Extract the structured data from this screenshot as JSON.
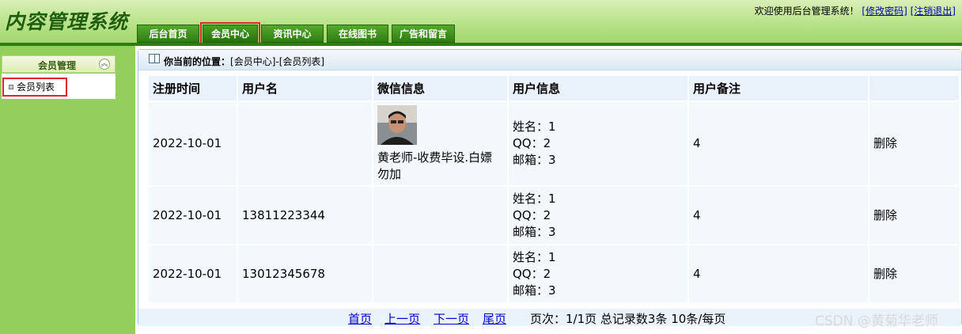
{
  "app": {
    "title": "内容管理系统"
  },
  "header": {
    "welcome_text": "欢迎使用后台管理系统！",
    "change_password": "[修改密码]",
    "logout": "[注销退出]"
  },
  "tabs": [
    {
      "label": "后台首页",
      "active": false
    },
    {
      "label": "会员中心",
      "active": true
    },
    {
      "label": "资讯中心",
      "active": false
    },
    {
      "label": "在线图书",
      "active": false
    },
    {
      "label": "广告和留言",
      "active": false
    }
  ],
  "sidebar": {
    "section_title": "会员管理",
    "items": [
      {
        "label": "会员列表",
        "selected": true
      }
    ]
  },
  "location": {
    "prefix": "你当前的位置：",
    "path": "[会员中心]-[会员列表]"
  },
  "table": {
    "headers": [
      "注册时间",
      "用户名",
      "微信信息",
      "用户信息",
      "用户备注",
      ""
    ],
    "rows": [
      {
        "reg_time": "2022-10-01",
        "username": "",
        "wechat_name": "黄老师-收费毕设.白嫖勿加",
        "has_avatar": true,
        "info_name": "姓名：1",
        "info_qq": "QQ：2",
        "info_email": "邮箱：3",
        "remark": "4",
        "action": "删除"
      },
      {
        "reg_time": "2022-10-01",
        "username": "13811223344",
        "wechat_name": "",
        "has_avatar": false,
        "info_name": "姓名：1",
        "info_qq": "QQ：2",
        "info_email": "邮箱：3",
        "remark": "4",
        "action": "删除"
      },
      {
        "reg_time": "2022-10-01",
        "username": "13012345678",
        "wechat_name": "",
        "has_avatar": false,
        "info_name": "姓名：1",
        "info_qq": "QQ：2",
        "info_email": "邮箱：3",
        "remark": "4",
        "action": "删除"
      }
    ]
  },
  "pager": {
    "first": "首页",
    "prev": "上一页",
    "next": "下一页",
    "last": "尾页",
    "info": "页次：1/1页   总记录数3条   10条/每页"
  },
  "watermark": "CSDN @黄菊华老师",
  "colors": {
    "header_green": "#2f7d10",
    "tab_green": "#3c8f1b",
    "sidebar_green": "#94cf5d",
    "highlight_red": "#e0242b",
    "link_blue": "#0000cc"
  }
}
